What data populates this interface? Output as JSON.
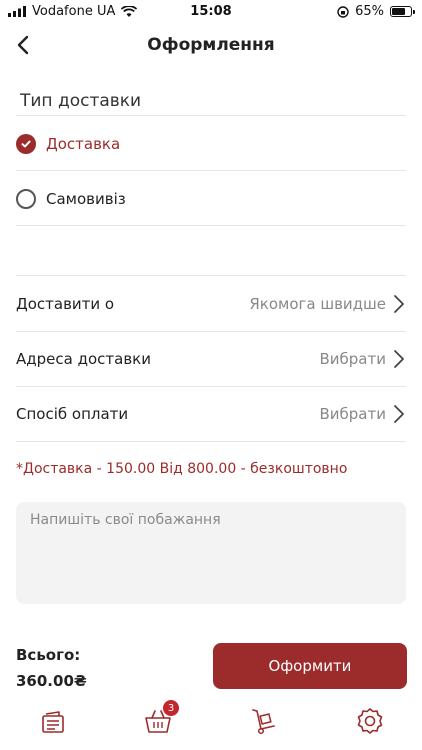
{
  "status_bar": {
    "carrier": "Vodafone UA",
    "time": "15:08",
    "battery": "65%",
    "battery_level": 0.65
  },
  "header": {
    "title": "Оформлення"
  },
  "delivery_type": {
    "title": "Тип доставки",
    "options": [
      {
        "label": "Доставка",
        "selected": true
      },
      {
        "label": "Самовивіз",
        "selected": false
      }
    ]
  },
  "details": [
    {
      "label": "Доставити о",
      "value": "Якомога швидше"
    },
    {
      "label": "Адреса доставки",
      "value": "Вибрати"
    },
    {
      "label": "Спосіб оплати",
      "value": "Вибрати"
    }
  ],
  "note": "*Доставка - 150.00 Від 800.00 - безкоштовно",
  "wish": {
    "placeholder": "Напишіть свої побажання",
    "value": ""
  },
  "total": {
    "label": "Всього:",
    "value": "360.00₴"
  },
  "submit_label": "Оформити",
  "tabbar": {
    "cart_count": "3",
    "icons": [
      "menu-icon",
      "cart-icon",
      "delivery-icon",
      "settings-icon"
    ]
  },
  "colors": {
    "accent": "#9c2b2b",
    "badge": "#c3262e"
  }
}
